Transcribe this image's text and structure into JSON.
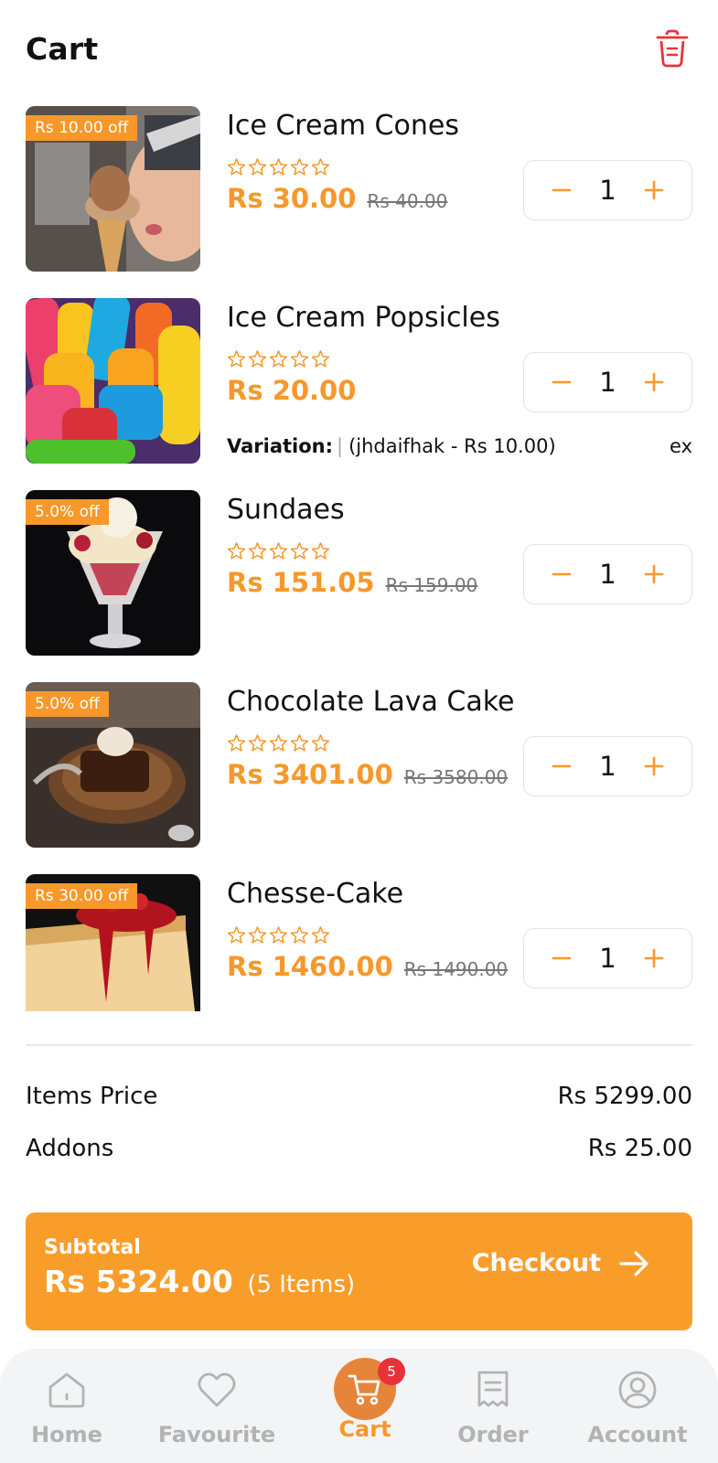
{
  "header": {
    "title": "Cart",
    "clear_icon": "trash-icon"
  },
  "items": [
    {
      "name": "Ice Cream Cones",
      "badge": "Rs 10.00 off",
      "price": "Rs 30.00",
      "old_price": "Rs 40.00",
      "rating": 0,
      "quantity": "1"
    },
    {
      "name": "Ice Cream Popsicles",
      "badge": "",
      "price": "Rs 20.00",
      "old_price": "",
      "rating": 0,
      "quantity": "1",
      "variation_label": "Variation:",
      "variation_value": "(jhdaifhak - Rs 10.00)",
      "variation_more": "ex"
    },
    {
      "name": "Sundaes",
      "badge": "5.0% off",
      "price": "Rs 151.05",
      "old_price": "Rs 159.00",
      "rating": 0,
      "quantity": "1"
    },
    {
      "name": "Chocolate Lava Cake",
      "badge": "5.0% off",
      "price": "Rs 3401.00",
      "old_price": "Rs 3580.00",
      "rating": 0,
      "quantity": "1"
    },
    {
      "name": "Chesse-Cake",
      "badge": "Rs 30.00 off",
      "price": "Rs 1460.00",
      "old_price": "Rs 1490.00",
      "rating": 0,
      "quantity": "1"
    }
  ],
  "summary": {
    "items_price_label": "Items Price",
    "items_price_value": "Rs 5299.00",
    "addons_label": "Addons",
    "addons_value": "Rs 25.00"
  },
  "checkout_bar": {
    "subtotal_label": "Subtotal",
    "subtotal_value": "Rs 5324.00",
    "items_count": "(5 Items)",
    "checkout_label": "Checkout",
    "background": "#f99d2a"
  },
  "nav": {
    "items": [
      {
        "label": "Home",
        "icon": "home-icon"
      },
      {
        "label": "Favourite",
        "icon": "heart-icon"
      },
      {
        "label": "Cart",
        "icon": "cart-icon",
        "active": true,
        "badge": "5"
      },
      {
        "label": "Order",
        "icon": "receipt-icon"
      },
      {
        "label": "Account",
        "icon": "user-icon"
      }
    ]
  },
  "colors": {
    "accent": "#f7982a",
    "danger": "#e8323a",
    "muted": "#b3b3b3"
  }
}
